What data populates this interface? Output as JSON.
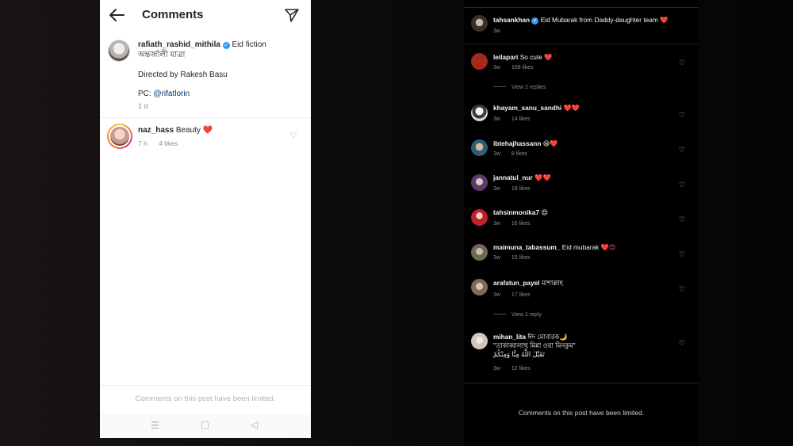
{
  "left": {
    "title": "Comments",
    "caption": {
      "username": "rafiath_rashid_mithila",
      "text": "Eid fiction",
      "line2": "অন্তর্জালী যাত্রা",
      "line3": "Directed by Rakesh Basu",
      "pc_prefix": "PC: ",
      "pc_mention": "@rifatlorin",
      "time": "1 d"
    },
    "comment": {
      "username": "naz_hass",
      "text": "Beauty",
      "emoji": "❤️",
      "time": "7 h",
      "likes": "4 likes"
    },
    "limited_text": "Comments on this post have been limited."
  },
  "right": {
    "caption": {
      "username": "tahsankhan",
      "text": "Eid Mubarak from Daddy-daughter team",
      "emoji": "❤️",
      "time": "3w"
    },
    "comments": [
      {
        "username": "leilapari",
        "text": "So cute",
        "emoji": "❤️",
        "time": "3w",
        "likes": "108 likes",
        "avatar_color": "#a3281e",
        "replies": "View 2 replies"
      },
      {
        "username": "khayam_sanu_sandhi",
        "text": "",
        "emoji": "❤️❤️",
        "time": "3w",
        "likes": "14 likes",
        "avatar_color": "#d9d4cf"
      },
      {
        "username": "ibtehajhassann",
        "text": "",
        "emoji": "😄❤️",
        "time": "3w",
        "likes": "8 likes",
        "avatar_color": "#2f5f70"
      },
      {
        "username": "jannatul_nur",
        "text": "",
        "emoji": "❤️❤️",
        "time": "3w",
        "likes": "18 likes",
        "avatar_color": "#5a3b6e"
      },
      {
        "username": "tahsinmonika7",
        "text": "",
        "emoji": "😍",
        "time": "3w",
        "likes": "16 likes",
        "avatar_color": "#c0202a"
      },
      {
        "username": "maimuna_tabassum_",
        "text": "Eid mubarak",
        "emoji": "❤️😍",
        "time": "3w",
        "likes": "15 likes",
        "avatar_color": "#6b6a55"
      },
      {
        "username": "arafatun_payel",
        "text": "মাশাল্লাহ",
        "emoji": "",
        "time": "3w",
        "likes": "17 likes",
        "avatar_color": "#7a6b5c",
        "replies": "View 1 reply"
      },
      {
        "username": "mihan_lita",
        "text": "ঈদ মোবারক",
        "emoji": "🌙",
        "line2": "\"তাকাব্বালাহু মিন্না ওয়া মিনকুম\"",
        "line3": "تَقَبَّلَ اللَّهُ مِنَّا وَمِنْكُمْ",
        "time": "3w",
        "likes": "12 likes",
        "avatar_color": "#cfc7bf"
      }
    ],
    "limited_text": "Comments on this post have been limited."
  },
  "icons": {
    "back": "back-arrow-icon",
    "send": "send-icon",
    "heart": "heart-outline-icon",
    "verified": "verified-badge-icon",
    "nav_menu": "menu-icon",
    "nav_home": "square-icon",
    "nav_back": "triangle-back-icon"
  }
}
